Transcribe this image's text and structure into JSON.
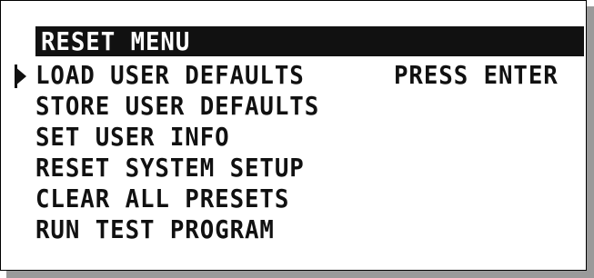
{
  "screen": {
    "title": "RESET MENU",
    "status": "PRESS ENTER",
    "selected_index": 0,
    "items": [
      {
        "label": "LOAD USER DEFAULTS"
      },
      {
        "label": "STORE USER DEFAULTS"
      },
      {
        "label": "SET USER INFO"
      },
      {
        "label": "RESET SYSTEM SETUP"
      },
      {
        "label": "CLEAR ALL PRESETS"
      },
      {
        "label": "RUN TEST PROGRAM"
      }
    ]
  },
  "icons": {
    "cursor": "selection-arrow-icon"
  }
}
